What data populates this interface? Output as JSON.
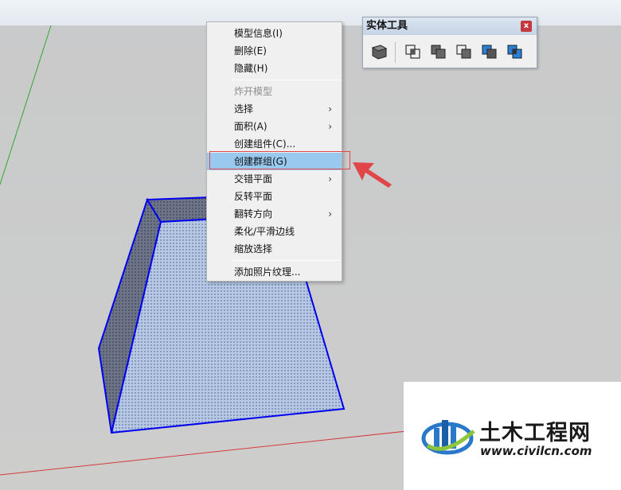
{
  "context_menu": {
    "items": [
      {
        "label": "模型信息(I)",
        "disabled": false,
        "submenu": false
      },
      {
        "label": "删除(E)",
        "disabled": false,
        "submenu": false
      },
      {
        "label": "隐藏(H)",
        "disabled": false,
        "submenu": false
      },
      {
        "label": "炸开模型",
        "disabled": true,
        "submenu": false
      },
      {
        "label": "选择",
        "disabled": false,
        "submenu": true
      },
      {
        "label": "面积(A)",
        "disabled": false,
        "submenu": true
      },
      {
        "label": "创建组件(C)...",
        "disabled": false,
        "submenu": false
      },
      {
        "label": "创建群组(G)",
        "disabled": false,
        "submenu": false,
        "highlighted": true
      },
      {
        "label": "交错平面",
        "disabled": false,
        "submenu": true
      },
      {
        "label": "反转平面",
        "disabled": false,
        "submenu": false
      },
      {
        "label": "翻转方向",
        "disabled": false,
        "submenu": true
      },
      {
        "label": "柔化/平滑边线",
        "disabled": false,
        "submenu": false
      },
      {
        "label": "缩放选择",
        "disabled": false,
        "submenu": false
      },
      {
        "label": "添加照片纹理...",
        "disabled": false,
        "submenu": false
      }
    ],
    "submenu_arrow": "›"
  },
  "solid_toolbar": {
    "title": "实体工具",
    "close_label": "x",
    "tools": [
      "outer-shell-icon",
      "intersect-icon",
      "union-icon",
      "subtract-icon",
      "trim-icon",
      "split-icon"
    ]
  },
  "watermark": {
    "title": "土木工程网",
    "url": "www.civilcn.com"
  },
  "colors": {
    "selection_edge": "#0000ee",
    "menu_highlight": "#99c9ef",
    "annotation_red": "#e0454a",
    "axis_green": "#2fa82f",
    "axis_red": "#d23c3c"
  }
}
